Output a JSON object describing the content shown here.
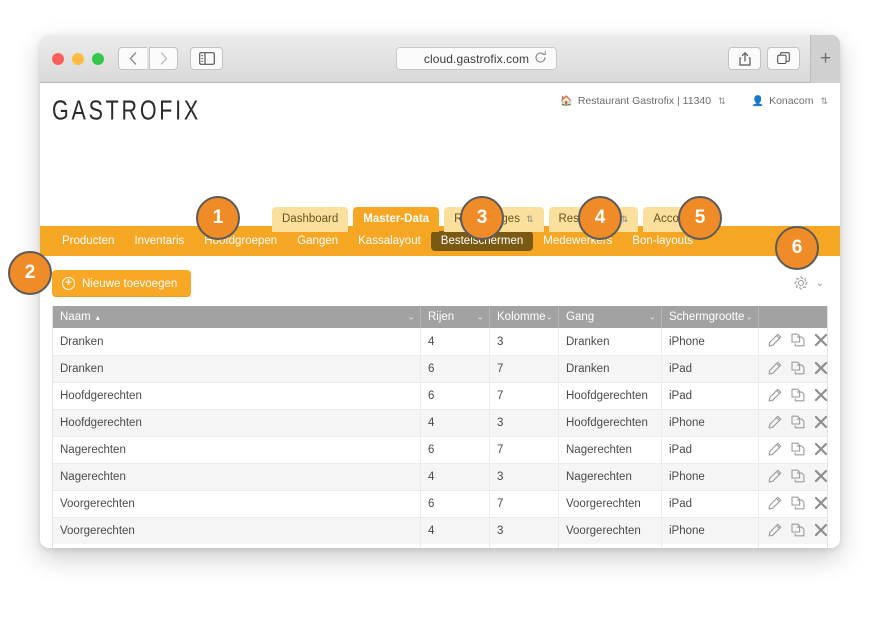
{
  "browser": {
    "url": "cloud.gastrofix.com",
    "traffic_lights": [
      "close-red",
      "minimize-yellow",
      "zoom-green"
    ],
    "back_label": "‹",
    "forward_label": "›",
    "reload_label": "↻",
    "new_tab_label": "+"
  },
  "app": {
    "logo": "GASTROFIX",
    "header_right": [
      {
        "icon": "home-icon",
        "label": "Restaurant Gastrofix | 11340",
        "caret": "⇅"
      },
      {
        "icon": "user-icon",
        "label": "Konacom",
        "caret": "⇅"
      }
    ],
    "tabs": [
      {
        "label": "Dashboard",
        "active": false,
        "caret": ""
      },
      {
        "label": "Master-Data",
        "active": true,
        "caret": ""
      },
      {
        "label": "Rapportages",
        "active": false,
        "caret": "⇅"
      },
      {
        "label": "Restaurant",
        "active": false,
        "caret": "⇅"
      },
      {
        "label": "Account",
        "active": false,
        "caret": "⇅"
      }
    ],
    "subnav": [
      {
        "label": "Producten",
        "active": false
      },
      {
        "label": "Inventaris",
        "active": false
      },
      {
        "label": "Hoofdgroepen",
        "active": false
      },
      {
        "label": "Gangen",
        "active": false
      },
      {
        "label": "Kassalayout",
        "active": false
      },
      {
        "label": "Bestelschermen",
        "active": true
      },
      {
        "label": "Medewerkers",
        "active": false
      },
      {
        "label": "Bon-layouts",
        "active": false
      }
    ],
    "toolbar": {
      "add_label": "Nieuwe toevoegen",
      "add_icon": "plus-circle-icon",
      "settings_icon": "gear-icon",
      "settings_caret": "⌄"
    },
    "table": {
      "columns": [
        {
          "key": "naam",
          "label": "Naam",
          "sorted": "asc",
          "sort_glyph": "▴",
          "caret": "⌄"
        },
        {
          "key": "rijen",
          "label": "Rijen",
          "sorted": "",
          "sort_glyph": "",
          "caret": "⌄"
        },
        {
          "key": "kolom",
          "label": "Kolomme",
          "sorted": "",
          "sort_glyph": "",
          "caret": "⌄"
        },
        {
          "key": "gang",
          "label": "Gang",
          "sorted": "",
          "sort_glyph": "",
          "caret": "⌄"
        },
        {
          "key": "scherm",
          "label": "Schermgrootte",
          "sorted": "",
          "sort_glyph": "",
          "caret": "⌄"
        },
        {
          "key": "acties",
          "label": "",
          "sorted": "",
          "sort_glyph": "",
          "caret": ""
        }
      ],
      "rows": [
        {
          "naam": "Dranken",
          "rijen": "4",
          "kolom": "3",
          "gang": "Dranken",
          "scherm": "iPhone"
        },
        {
          "naam": "Dranken",
          "rijen": "6",
          "kolom": "7",
          "gang": "Dranken",
          "scherm": "iPad"
        },
        {
          "naam": "Hoofdgerechten",
          "rijen": "6",
          "kolom": "7",
          "gang": "Hoofdgerechten",
          "scherm": "iPad"
        },
        {
          "naam": "Hoofdgerechten",
          "rijen": "4",
          "kolom": "3",
          "gang": "Hoofdgerechten",
          "scherm": "iPhone"
        },
        {
          "naam": "Nagerechten",
          "rijen": "6",
          "kolom": "7",
          "gang": "Nagerechten",
          "scherm": "iPad"
        },
        {
          "naam": "Nagerechten",
          "rijen": "4",
          "kolom": "3",
          "gang": "Nagerechten",
          "scherm": "iPhone"
        },
        {
          "naam": "Voorgerechten",
          "rijen": "6",
          "kolom": "7",
          "gang": "Voorgerechten",
          "scherm": "iPad"
        },
        {
          "naam": "Voorgerechten",
          "rijen": "4",
          "kolom": "3",
          "gang": "Voorgerechten",
          "scherm": "iPhone"
        }
      ],
      "row_actions": [
        {
          "icon": "pencil-icon",
          "name": "edit"
        },
        {
          "icon": "copy-icon",
          "name": "duplicate"
        },
        {
          "icon": "close-icon",
          "name": "delete"
        }
      ]
    },
    "callouts": [
      {
        "id": "1",
        "label": "1"
      },
      {
        "id": "2",
        "label": "2"
      },
      {
        "id": "3",
        "label": "3"
      },
      {
        "id": "4",
        "label": "4"
      },
      {
        "id": "5",
        "label": "5"
      },
      {
        "id": "6",
        "label": "6"
      }
    ]
  },
  "colors": {
    "brand_orange": "#f5a623",
    "active_subnav": "#7a5a13",
    "callout": "#f08c28",
    "header_gray": "#a2a2a2"
  }
}
